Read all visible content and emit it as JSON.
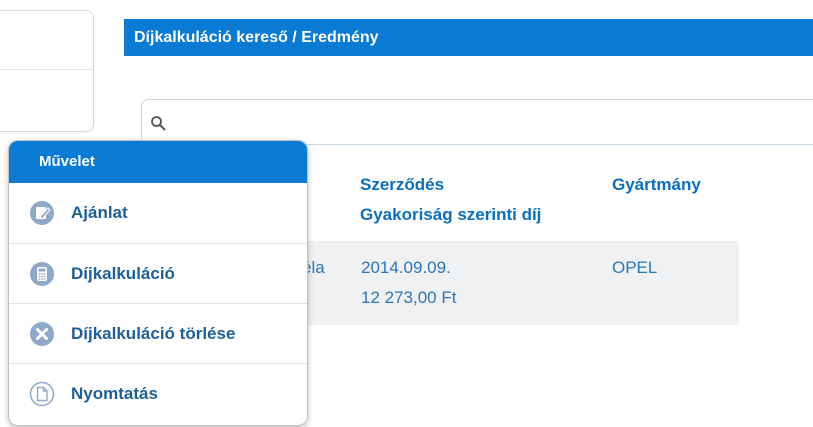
{
  "header": {
    "title": "Díjkalkuláció kereső / Eredmény"
  },
  "search": {
    "value": "",
    "placeholder": ""
  },
  "table": {
    "columns": [
      {
        "line1": "Szerződés",
        "line2": "Gyakoriság szerinti díj"
      },
      {
        "line1": "Gyártmány"
      }
    ],
    "rows": [
      {
        "partial_name": "éla",
        "date": "2014.09.09.",
        "fee": "12 273,00 Ft",
        "make": "OPEL"
      }
    ]
  },
  "menu": {
    "title": "Művelet",
    "items": [
      {
        "label": "Ajánlat",
        "icon": "edit-icon"
      },
      {
        "label": "Díjkalkuláció",
        "icon": "calculator-icon"
      },
      {
        "label": "Díjkalkuláció törlése",
        "icon": "delete-icon"
      },
      {
        "label": "Nyomtatás",
        "icon": "document-icon"
      }
    ]
  },
  "colors": {
    "primary": "#0a7bd4",
    "link": "#1e5f97",
    "icon": "#8ea9c8"
  }
}
